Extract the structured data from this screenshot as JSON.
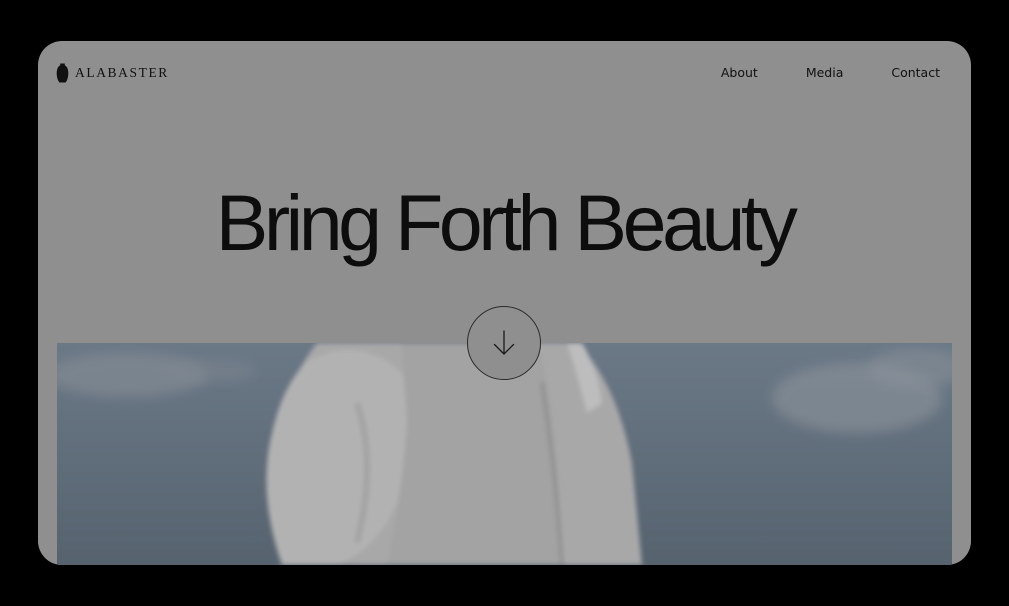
{
  "brand": {
    "name": "ALABASTER",
    "logo_icon": "alabaster-jar-icon"
  },
  "nav": {
    "items": [
      {
        "label": "About"
      },
      {
        "label": "Media"
      },
      {
        "label": "Contact"
      }
    ]
  },
  "hero": {
    "headline": "Bring Forth Beauty",
    "scroll_icon": "arrow-down-icon",
    "image": "photo of a person in a white garment against a blue sky"
  },
  "colors": {
    "overlay": "#8f8f8f",
    "text": "#111111",
    "sky": "#5e6b79",
    "frame": "#000000"
  }
}
